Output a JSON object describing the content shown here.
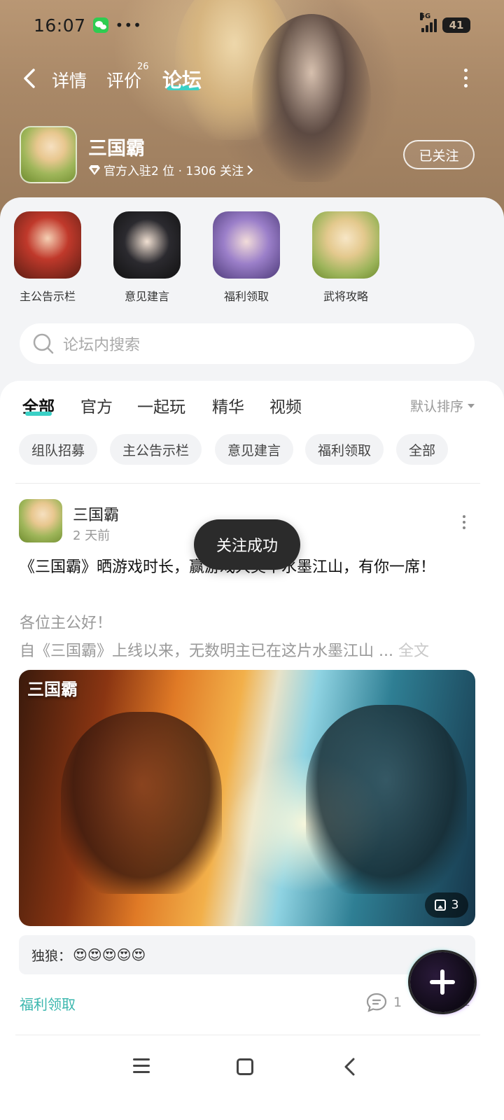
{
  "status_bar": {
    "time": "16:07",
    "network": "5G",
    "battery": "41",
    "icons": [
      "wechat-icon",
      "more-dots-icon",
      "signal-icon",
      "battery-icon"
    ]
  },
  "nav": {
    "back_icon": "chevron-left-icon",
    "tabs": [
      "详情",
      "评价",
      "论坛"
    ],
    "review_count": "26",
    "active_tab": "论坛",
    "more_icon": "vertical-dots-icon"
  },
  "game": {
    "name": "三国霸",
    "meta": "官方入驻2 位 · 1306 关注",
    "follow_label": "已关注"
  },
  "boards": [
    {
      "label": "主公告示栏"
    },
    {
      "label": "意见建言"
    },
    {
      "label": "福利领取"
    },
    {
      "label": "武将攻略"
    }
  ],
  "search": {
    "placeholder": "论坛内搜索"
  },
  "tabs": [
    "全部",
    "官方",
    "一起玩",
    "精华",
    "视频"
  ],
  "sort_label": "默认排序",
  "chips": [
    "组队招募",
    "主公告示栏",
    "意见建言",
    "福利领取",
    "全部"
  ],
  "post": {
    "author": "三国霸",
    "time": "2 天前",
    "title": "《三国霸》晒游戏时长，赢游戏大奖丨水墨江山，有你一席！",
    "excerpt1": "各位主公好！",
    "excerpt2": "自《三国霸》上线以来，无数明主已在这片水墨江山",
    "ellipsis": " ... ",
    "fulltext": "全文",
    "image_logo": "三国霸",
    "image_count": "3",
    "comment_preview": "独狼：",
    "comment_emoji": "😍😍😍😍😍",
    "tag": "福利领取",
    "comment_count": "1",
    "like_count": "2"
  },
  "toast": "关注成功",
  "colors": {
    "accent": "#3ad0c6",
    "tag_color": "#3bb7ae",
    "sheet_bg": "#f3f4f6"
  }
}
